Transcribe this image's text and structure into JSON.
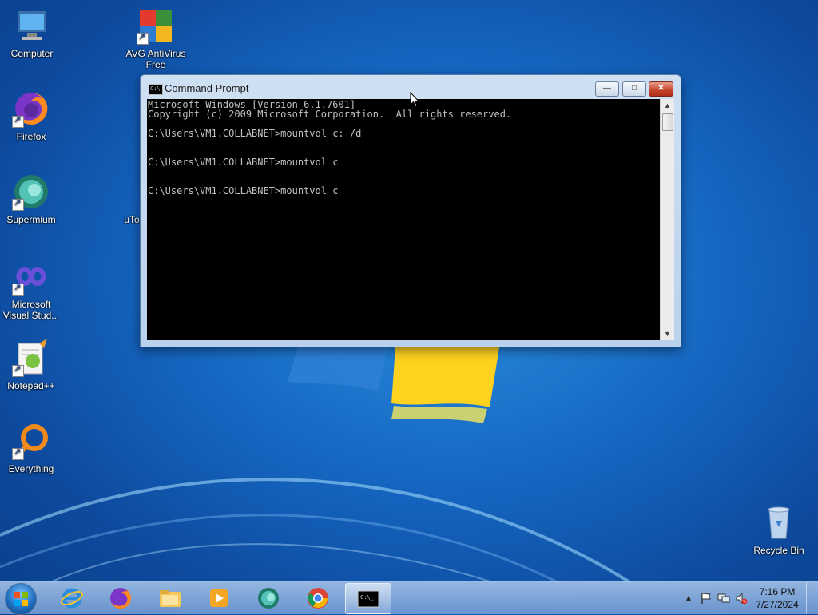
{
  "desktop": {
    "icons": [
      {
        "label": "Computer"
      },
      {
        "label": "AVG AntiVirus Free"
      },
      {
        "label": "Firefox"
      },
      {
        "label": "Supermium"
      },
      {
        "label": "Microsoft Visual Stud..."
      },
      {
        "label": "Notepad++"
      },
      {
        "label": "Everything"
      },
      {
        "label": "uTo"
      },
      {
        "label": "Recycle Bin"
      }
    ]
  },
  "cmd_window": {
    "title": "Command Prompt",
    "min_glyph": "—",
    "max_glyph": "□",
    "close_glyph": "✕",
    "lines": [
      "Microsoft Windows [Version 6.1.7601]",
      "Copyright (c) 2009 Microsoft Corporation.  All rights reserved.",
      "",
      "C:\\Users\\VM1.COLLABNET>mountvol c: /d",
      "",
      "",
      "C:\\Users\\VM1.COLLABNET>mountvol c",
      "",
      "",
      "C:\\Users\\VM1.COLLABNET>mountvol c"
    ],
    "scroll_up": "▲",
    "scroll_down": "▼"
  },
  "taskbar": {
    "pinned": [
      {
        "name": "Internet Explorer",
        "icon": "internet-explorer-icon"
      },
      {
        "name": "Firefox",
        "icon": "firefox-icon"
      },
      {
        "name": "Windows Explorer",
        "icon": "folder-icon"
      },
      {
        "name": "Windows Media Player",
        "icon": "media-player-icon"
      },
      {
        "name": "Supermium",
        "icon": "supermium-icon"
      },
      {
        "name": "Google Chrome",
        "icon": "chrome-icon"
      },
      {
        "name": "Command Prompt",
        "icon": "command-prompt-icon"
      }
    ],
    "tray": {
      "show_hidden": "▴",
      "time": "7:16 PM",
      "date": "7/27/2024"
    }
  },
  "colors": {
    "console_bg": "#000000",
    "console_text": "#c0c0c0",
    "close_button": "#c3442b",
    "desktop_blue": "#1565c0"
  }
}
